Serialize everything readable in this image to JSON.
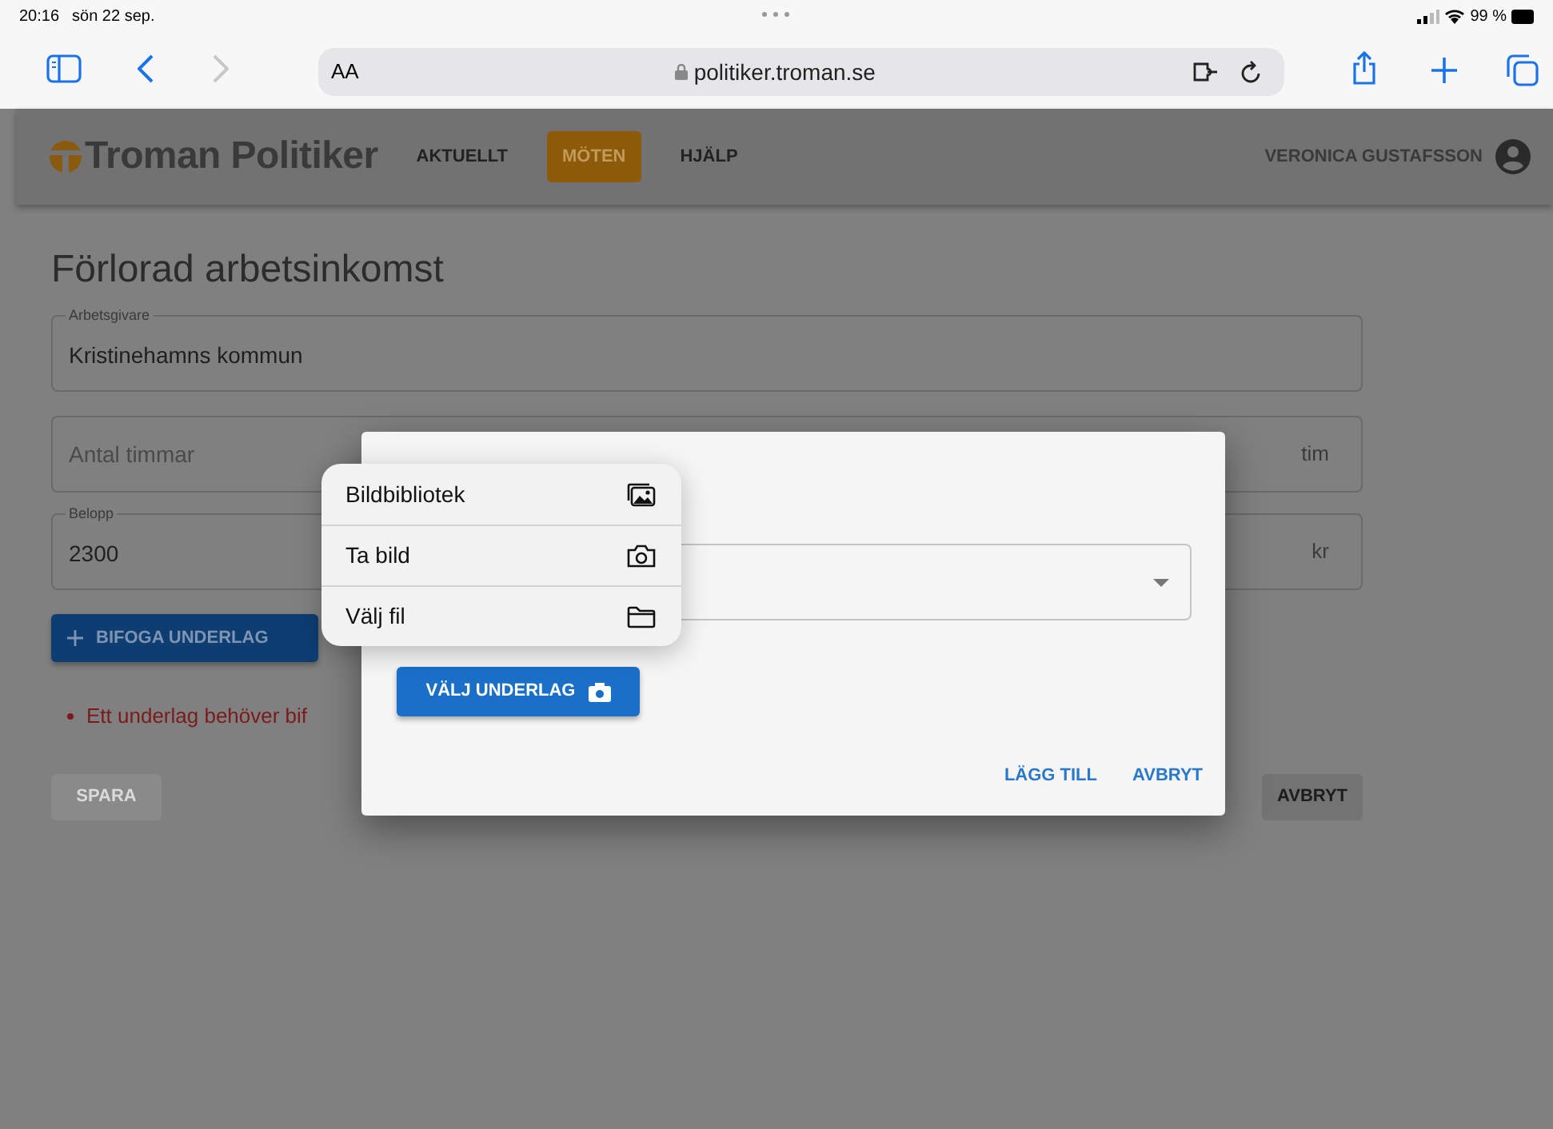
{
  "status_bar": {
    "time": "20:16",
    "date": "sön 22 sep.",
    "battery": "99 %"
  },
  "browser": {
    "text_size": "AA",
    "url": "politiker.troman.se",
    "forward_disabled": true
  },
  "header": {
    "logo": "Troman Politiker",
    "nav": [
      {
        "label": "AKTUELLT",
        "selected": false
      },
      {
        "label": "MÖTEN",
        "selected": true
      },
      {
        "label": "HJÄLP",
        "selected": false
      }
    ],
    "user": "VERONICA GUSTAFSSON"
  },
  "page": {
    "title": "Förlorad arbetsinkomst",
    "fields": [
      {
        "label": "Arbetsgivare",
        "value": "Kristinehamns kommun"
      },
      {
        "placeholder": "Antal timmar",
        "suffix": "tim"
      },
      {
        "label": "Belopp",
        "value": "2300",
        "suffix": "kr"
      }
    ],
    "attach_button": "BIFOGA UNDERLAG",
    "errors": [
      "Ett underlag behöver bif"
    ],
    "save_button": {
      "label": "SPARA",
      "disabled": true
    },
    "cancel_button": "AVBRYT"
  },
  "dialog": {
    "choose_button": "VÄLJ UNDERLAG",
    "actions": [
      "LÄGG TILL",
      "AVBRYT"
    ]
  },
  "menu": {
    "items": [
      {
        "label": "Bildbibliotek",
        "kind": "photos"
      },
      {
        "label": "Ta bild",
        "kind": "camera"
      },
      {
        "label": "Välj fil",
        "kind": "folder"
      }
    ]
  }
}
